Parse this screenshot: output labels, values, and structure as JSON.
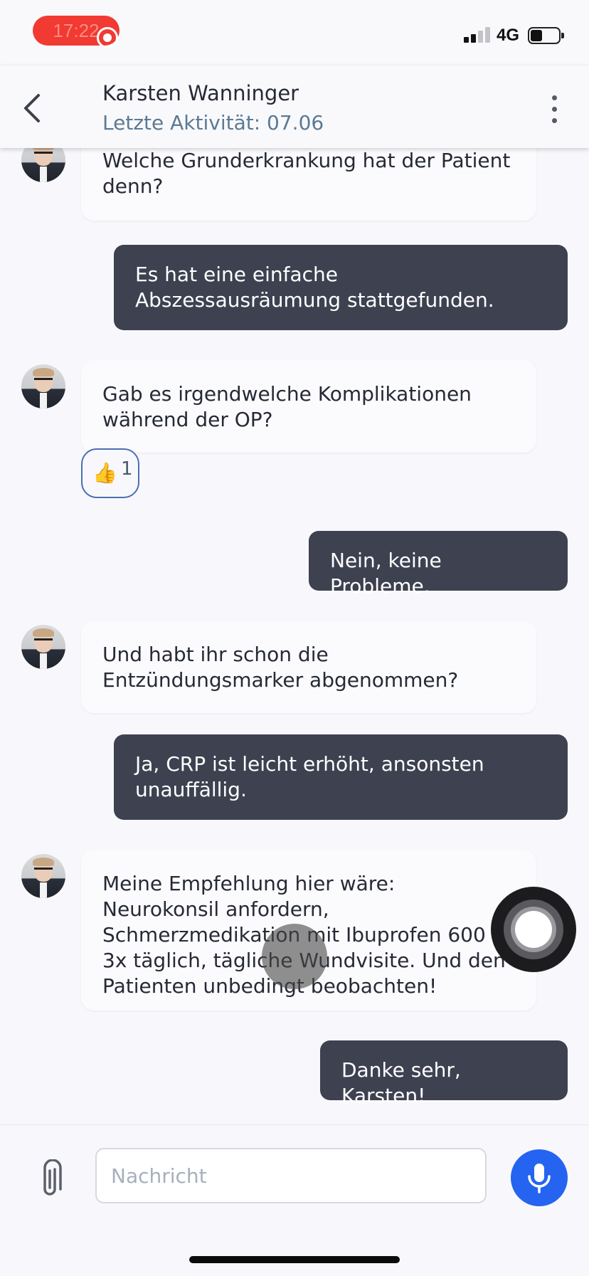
{
  "status_bar": {
    "recording_time": "17:22",
    "network": "4G",
    "signal_bars": [
      {
        "h": 8,
        "active": true
      },
      {
        "h": 12,
        "active": true
      },
      {
        "h": 17,
        "active": false
      },
      {
        "h": 22,
        "active": false
      }
    ]
  },
  "header": {
    "contact_name": "Karsten Wanninger",
    "last_activity": "Letzte Aktivität: 07.06"
  },
  "messages": [
    {
      "direction": "in",
      "text": "Welche Grunderkrankung hat der Patient\ndenn?"
    },
    {
      "direction": "out",
      "text": "Es hat eine einfache\nAbszessausräumung stattgefunden."
    },
    {
      "direction": "in",
      "text": "Gab es irgendwelche Komplikationen\nwährend der OP?",
      "reaction": {
        "emoji": "👍",
        "count": "1"
      }
    },
    {
      "direction": "out",
      "text": "Nein, keine Probleme."
    },
    {
      "direction": "in",
      "text": "Und habt ihr schon die\nEntzündungsmarker abgenommen?"
    },
    {
      "direction": "out",
      "text": "Ja, CRP ist leicht erhöht, ansonsten\nunauffällig."
    },
    {
      "direction": "in",
      "text": "Meine Empfehlung hier wäre:\nNeurokonsil anfordern,\nSchmerzmedikation mit Ibuprofen 600\n3x täglich, tägliche Wundvisite. Und den\nPatienten unbedingt beobachten!"
    },
    {
      "direction": "out",
      "text": "Danke sehr, Karsten!"
    }
  ],
  "composer": {
    "placeholder": "Nachricht"
  },
  "colors": {
    "outgoing_bubble": "#3d4150",
    "accent_blue": "#2564f0",
    "subtitle": "#5b7a95"
  }
}
